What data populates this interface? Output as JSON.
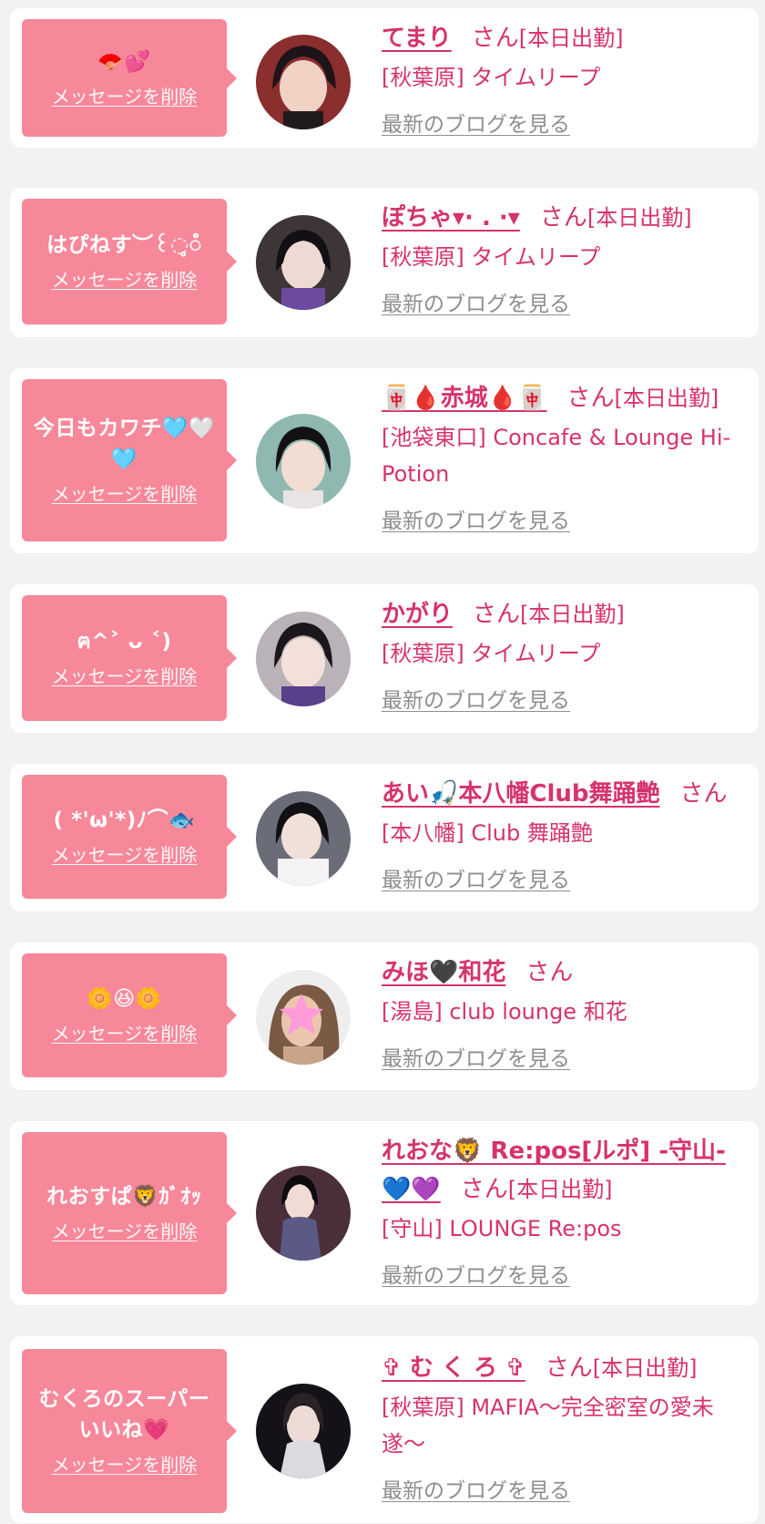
{
  "theme": {
    "accent": "#d6336c",
    "bubble": "#f7889a",
    "link_gray": "#8e8e8e",
    "bg": "#f2f2f4",
    "card": "#ffffff"
  },
  "entries": [
    {
      "message": "🪭💕",
      "delete_label": "メッセージを削除",
      "name": "てまり",
      "san": "さん",
      "status": "[本日出勤]",
      "shop": "[秋葉原] タイムリープ",
      "blog_label": "最新のブログを見る",
      "avatar_icon": "avatar-photo"
    },
    {
      "message": "はぴねす︶꒰◌̥̥̥ꠋ",
      "delete_label": "メッセージを削除",
      "name": "ぽちゃ▾· . ·▾",
      "san": "さん",
      "status": "[本日出勤]",
      "shop": "[秋葉原] タイムリープ",
      "blog_label": "最新のブログを見る",
      "avatar_icon": "avatar-photo"
    },
    {
      "message": "今日もカワチ🩵🤍🩵",
      "delete_label": "メッセージを削除",
      "name": "🀄🩸赤城🩸🀄",
      "san": "さん",
      "status": "[本日出勤]",
      "shop": "[池袋東口] Concafe & Lounge Hi-Potion",
      "blog_label": "最新のブログを見る",
      "avatar_icon": "avatar-photo"
    },
    {
      "message": "ฅ^˃ ᴗ ˂)",
      "delete_label": "メッセージを削除",
      "name": "かがり",
      "san": "さん",
      "status": "[本日出勤]",
      "shop": "[秋葉原] タイムリープ",
      "blog_label": "最新のブログを見る",
      "avatar_icon": "avatar-photo"
    },
    {
      "message": "( *'ω'*)ﾉ⌒🐟",
      "delete_label": "メッセージを削除",
      "name": "あい🎣本八幡Club舞踊艶",
      "san": "さん",
      "status": "",
      "shop": "[本八幡] Club 舞踊艶",
      "blog_label": "最新のブログを見る",
      "avatar_icon": "avatar-photo"
    },
    {
      "message": "🌼😆🌼",
      "delete_label": "メッセージを削除",
      "name": "みほ🖤和花",
      "san": "さん",
      "status": "",
      "shop": "[湯島] club lounge 和花",
      "blog_label": "最新のブログを見る",
      "avatar_icon": "avatar-photo-star"
    },
    {
      "message": "れおすぱ🦁ｶﾞｵｯ",
      "delete_label": "メッセージを削除",
      "name": "れおな🦁 Re:pos[ルポ] -守山-💙💜",
      "san": "さん",
      "status": "[本日出勤]",
      "shop": "[守山] LOUNGE Re:pos",
      "blog_label": "最新のブログを見る",
      "avatar_icon": "avatar-photo"
    },
    {
      "message": "むくろのスーパーいいね💗",
      "delete_label": "メッセージを削除",
      "name": "✞ む く ろ ✞",
      "san": "さん",
      "status": "[本日出勤]",
      "shop": "[秋葉原] MAFIA〜完全密室の愛未遂〜",
      "blog_label": "最新のブログを見る",
      "avatar_icon": "avatar-photo"
    }
  ]
}
